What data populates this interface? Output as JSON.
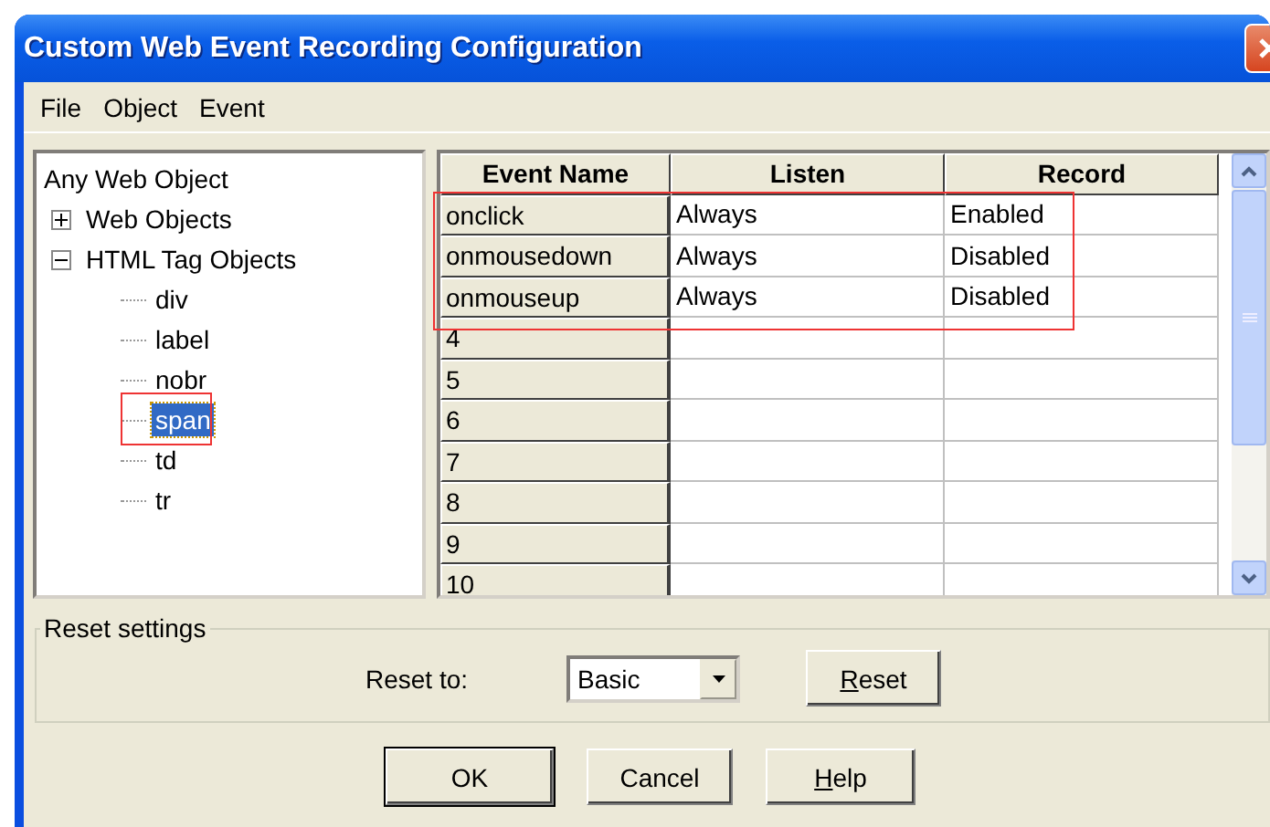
{
  "window": {
    "title": "Custom Web Event Recording Configuration"
  },
  "menu": [
    {
      "label": "File"
    },
    {
      "label": "Object"
    },
    {
      "label": "Event"
    }
  ],
  "tree": {
    "label": "Any Web Object",
    "children": [
      {
        "label": "Web Objects",
        "expanded": false,
        "selected": false
      },
      {
        "label": "HTML Tag Objects",
        "expanded": true,
        "selected": false,
        "children": [
          {
            "label": "div",
            "selected": false
          },
          {
            "label": "label",
            "selected": false
          },
          {
            "label": "nobr",
            "selected": false
          },
          {
            "label": "span",
            "selected": true
          },
          {
            "label": "td",
            "selected": false
          },
          {
            "label": "tr",
            "selected": false
          }
        ]
      }
    ]
  },
  "table": {
    "columns": [
      "Event Name",
      "Listen",
      "Record"
    ],
    "rows": [
      {
        "name": "onclick",
        "listen": "Always",
        "record": "Enabled"
      },
      {
        "name": "onmousedown",
        "listen": "Always",
        "record": "Disabled"
      },
      {
        "name": "onmouseup",
        "listen": "Always",
        "record": "Disabled"
      },
      {
        "name": "4"
      },
      {
        "name": "5"
      },
      {
        "name": "6"
      },
      {
        "name": "7"
      },
      {
        "name": "8"
      },
      {
        "name": "9"
      },
      {
        "name": "10"
      }
    ]
  },
  "reset_group": {
    "title": "Reset settings",
    "label": "Reset to:",
    "select_value": "Basic",
    "button": {
      "label": "Reset",
      "underline_first": true
    }
  },
  "buttons": [
    {
      "label": "OK",
      "default": true,
      "underline_first": false
    },
    {
      "label": "Cancel",
      "default": false,
      "underline_first": false
    },
    {
      "label": "Help",
      "default": false,
      "underline_first": true
    }
  ]
}
